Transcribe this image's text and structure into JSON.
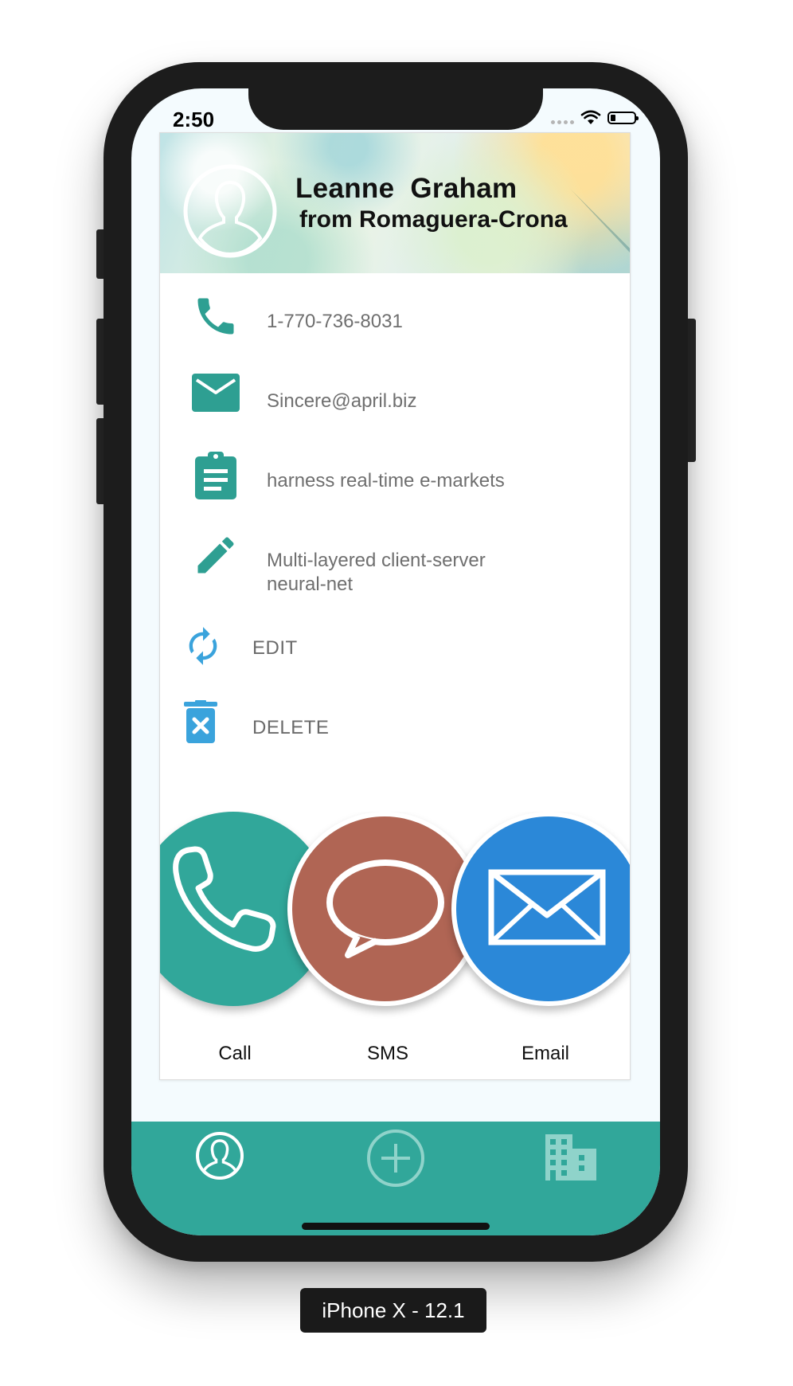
{
  "status_bar": {
    "time": "2:50"
  },
  "contact": {
    "name": "Leanne  Graham",
    "company_line": "from Romaguera-Crona",
    "phone": "1-770-736-8031",
    "email": "Sincere@april.biz",
    "bs": "harness real-time e-markets",
    "catch_phrase_line1": "Multi-layered client-server",
    "catch_phrase_line2": "neural-net"
  },
  "actions": {
    "edit": "EDIT",
    "delete": "DELETE"
  },
  "quick_actions": {
    "call": "Call",
    "sms": "SMS",
    "email": "Email"
  },
  "colors": {
    "teal": "#31a79a",
    "icon_teal": "#2e9f92",
    "action_blue": "#3aa3dc",
    "sms_brown": "#b06554",
    "email_blue": "#2b88d8"
  },
  "icons": {
    "phone": "phone-icon",
    "email": "envelope-icon",
    "bs": "clipboard-icon",
    "catch_phrase": "pencil-icon",
    "edit": "refresh-icon",
    "delete": "trash-icon",
    "tab_contacts": "person-icon",
    "tab_add": "plus-circle-icon",
    "tab_company": "building-icon"
  },
  "device_label": "iPhone X - 12.1"
}
